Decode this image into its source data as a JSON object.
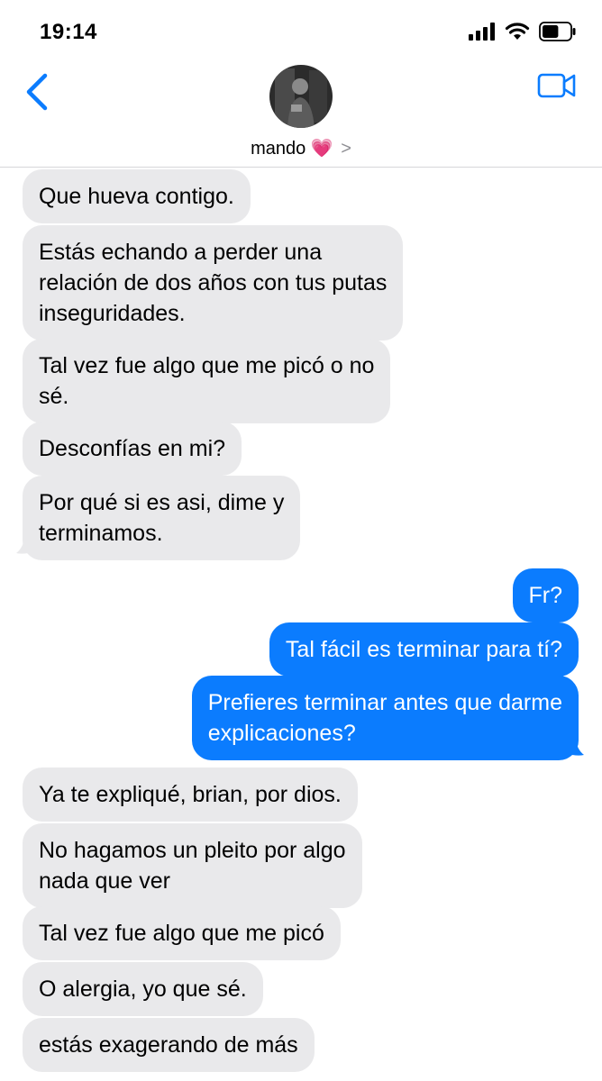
{
  "status_bar": {
    "time": "19:14",
    "battery_level": 0.6
  },
  "header": {
    "contact_name": "mando",
    "contact_emoji": "💗",
    "chevron": ">"
  },
  "icons": {
    "back": "chevron-left-icon",
    "video": "video-camera-icon"
  },
  "colors": {
    "accent": "#0b7cfe",
    "received_bubble": "#e9e9eb",
    "sent_text": "#ffffff"
  },
  "messages": [
    {
      "side": "received",
      "text": "Que hueva contigo."
    },
    {
      "side": "received",
      "lines": [
        "Estás echando a perder una",
        "relación de dos años con tus putas",
        "inseguridades."
      ]
    },
    {
      "side": "received",
      "lines": [
        "Tal vez fue algo que me picó o no",
        "sé."
      ]
    },
    {
      "side": "received",
      "text": "Desconfías en mi?"
    },
    {
      "side": "received",
      "lines": [
        "Por qué si es asi, dime y",
        "terminamos."
      ]
    },
    {
      "side": "sent",
      "text": "Fr?"
    },
    {
      "side": "sent",
      "text": "Tal fácil es terminar para tí?"
    },
    {
      "side": "sent",
      "lines": [
        "Prefieres terminar antes que darme",
        "explicaciones?"
      ]
    },
    {
      "side": "received",
      "text": "Ya te expliqué, brian, por dios."
    },
    {
      "side": "received",
      "lines": [
        "No hagamos un pleito por algo",
        "nada que ver"
      ]
    },
    {
      "side": "received",
      "text": "Tal vez fue algo que me picó"
    },
    {
      "side": "received",
      "text": "O alergia, yo que sé."
    },
    {
      "side": "received",
      "text": "estás exagerando de más"
    }
  ]
}
